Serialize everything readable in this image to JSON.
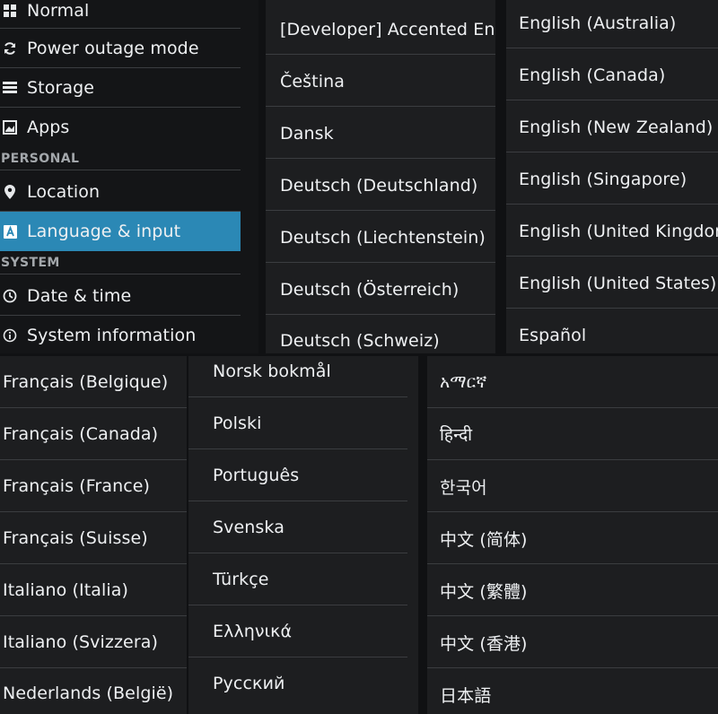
{
  "settings": {
    "items": [
      {
        "label": "Normal",
        "icon": "grid-icon"
      },
      {
        "label": "Power outage mode",
        "icon": "refresh-icon"
      },
      {
        "label": "Storage",
        "icon": "storage-icon"
      },
      {
        "label": "Apps",
        "icon": "apps-icon"
      },
      {
        "label": "Location",
        "icon": "location-icon"
      },
      {
        "label": "Language & input",
        "icon": "keyboard-a-icon",
        "selected": true
      },
      {
        "label": "Date & time",
        "icon": "clock-icon"
      },
      {
        "label": "System information",
        "icon": "info-icon"
      }
    ],
    "headers": {
      "personal": "PERSONAL",
      "system": "SYSTEM"
    },
    "accent_color": "#2b88b5"
  },
  "language_lists": {
    "panel1": [
      "[Developer] Accented English",
      "Čeština",
      "Dansk",
      "Deutsch (Deutschland)",
      "Deutsch (Liechtenstein)",
      "Deutsch (Österreich)",
      "Deutsch (Schweiz)"
    ],
    "panel2": [
      "English (Australia)",
      "English (Canada)",
      "English (New Zealand)",
      "English (Singapore)",
      "English (United Kingdom)",
      "English (United States)",
      "Español"
    ],
    "panel3": [
      "Français (Belgique)",
      "Français (Canada)",
      "Français (France)",
      "Français (Suisse)",
      "Italiano (Italia)",
      "Italiano (Svizzera)",
      "Nederlands (België)"
    ],
    "panel4": [
      "Norsk bokmål",
      "Polski",
      "Português",
      "Svenska",
      "Türkçe",
      "Ελληνικά",
      "Русский"
    ],
    "panel5": [
      "አማርኛ",
      "हिन्दी",
      "한국어",
      "中文 (简体)",
      "中文 (繁體)",
      "中文 (香港)",
      "日本語"
    ]
  }
}
